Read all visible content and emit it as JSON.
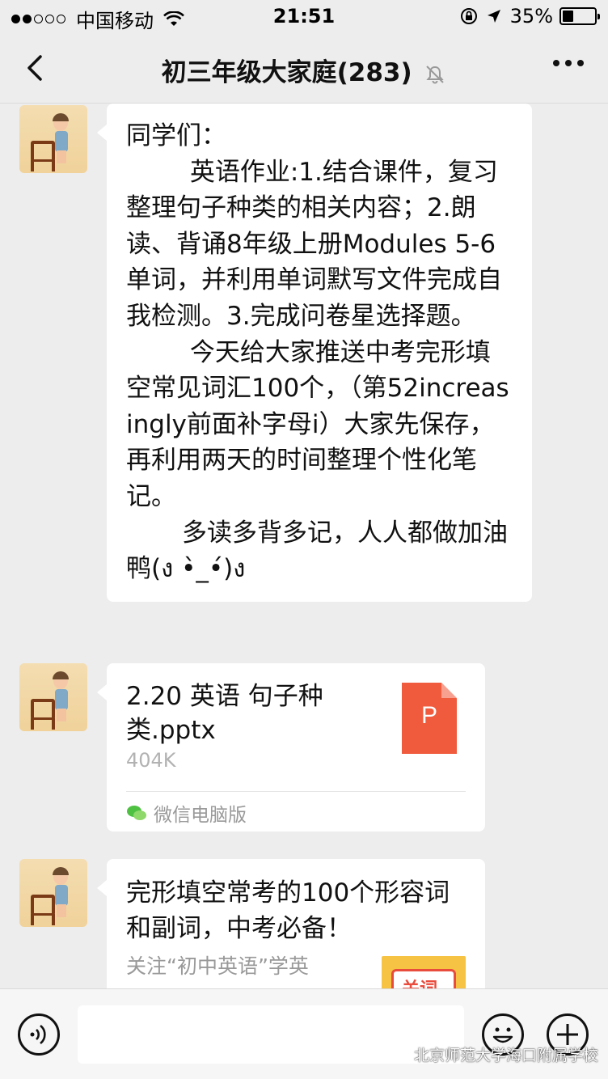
{
  "status_bar": {
    "carrier": "中国移动",
    "time": "21:51",
    "battery": "35%",
    "battery_level": 0.35,
    "signal_bars_filled": 2,
    "signal_bars_total": 5
  },
  "nav": {
    "title": "初三年级大家庭(283)",
    "icons": [
      "back-icon",
      "mute-bell-icon",
      "more-icon"
    ]
  },
  "messages": [
    {
      "type": "text",
      "text": "同学们：\n        英语作业:1.结合课件，复习整理句子种类的相关内容；2.朗读、背诵8年级上册Modules 5-6单词，并利用单词默写文件完成自我检测。3.完成问卷星选择题。\n        今天给大家推送中考完形填空常见词汇100个，（第52increasingly前面补字母i）大家先保存，再利用两天的时间整理个性化笔记。\n       多读多背多记，人人都做加油鸭(ง •̀_•́)ง"
    },
    {
      "type": "file",
      "file_name": "2.20 英语  句子种类.pptx",
      "file_size": "404K",
      "file_icon_letter": "P",
      "source": "微信电脑版"
    },
    {
      "type": "article",
      "title": "完形填空常考的100个形容词和副词，中考必备！",
      "description": "关注“初中英语”学英",
      "thumb_text": "关词"
    }
  ],
  "input_bar": {
    "icons": [
      "voice-icon",
      "emoji-icon",
      "plus-icon"
    ]
  },
  "watermark": {
    "text": "北京师范大学海口附属学校"
  },
  "colors": {
    "background": "#ededed",
    "bubble": "#ffffff",
    "file_icon": "#f05b3d",
    "secondary_text": "#999999"
  }
}
